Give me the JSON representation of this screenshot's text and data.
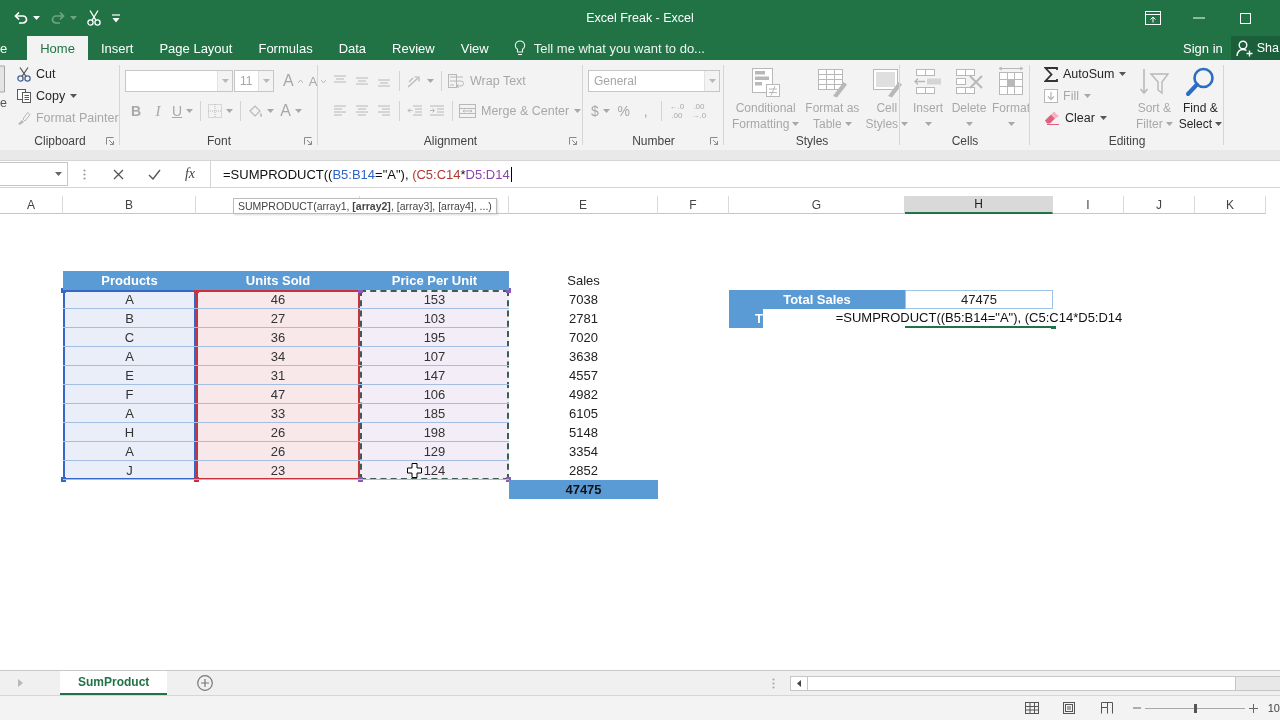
{
  "title_bar": {
    "quick_access": [
      {
        "disabled": false,
        "dropdown": true
      },
      {
        "disabled": true,
        "dropdown": true
      },
      {
        "disabled": false,
        "dropdown": false
      },
      {
        "disabled": false,
        "dropdown": false
      }
    ],
    "title": "Excel Freak - Excel"
  },
  "tabs": [
    {
      "label": "e",
      "selected": false
    },
    {
      "label": "Home",
      "selected": true
    },
    {
      "label": "Insert",
      "selected": false
    },
    {
      "label": "Page Layout",
      "selected": false
    },
    {
      "label": "Formulas",
      "selected": false
    },
    {
      "label": "Data",
      "selected": false
    },
    {
      "label": "Review",
      "selected": false
    },
    {
      "label": "View",
      "selected": false
    }
  ],
  "tell_me": "Tell me what you want to do...",
  "account": {
    "sign_in": "Sign in",
    "share": "Sha"
  },
  "ribbon": {
    "groups": [
      {
        "label": "Clipboard",
        "launcher": true,
        "stacks": [
          {
            "lines": [
              {
                "items": [
                  {
                    "kind": "fragment",
                    "label": "e"
                  }
                ]
              }
            ]
          },
          {
            "lines": [
              {
                "items": [
                  {
                    "kind": "small",
                    "label": "Cut",
                    "disabled": false,
                    "dropdown": false
                  }
                ]
              },
              {
                "items": [
                  {
                    "kind": "small",
                    "label": "Copy",
                    "disabled": false,
                    "dropdown": true
                  }
                ]
              },
              {
                "items": [
                  {
                    "kind": "small",
                    "label": "Format Painter",
                    "disabled": true,
                    "dropdown": false
                  }
                ]
              }
            ]
          }
        ]
      },
      {
        "label": "Font",
        "launcher": true,
        "stacks": [
          {
            "lines": [
              {
                "items": [
                  {
                    "kind": "combo",
                    "disabled": true
                  },
                  {
                    "kind": "combo",
                    "value": "11",
                    "disabled": true
                  },
                  {
                    "kind": "tool",
                    "label": "A",
                    "disabled": true,
                    "dropdown": false
                  },
                  {
                    "kind": "tool",
                    "label": "A",
                    "disabled": true,
                    "dropdown": false
                  }
                ]
              },
              {
                "items": [
                  {
                    "kind": "tool",
                    "label": "B",
                    "disabled": true,
                    "dropdown": false
                  },
                  {
                    "kind": "tool",
                    "label": "I",
                    "disabled": true,
                    "dropdown": false
                  },
                  {
                    "kind": "tool",
                    "label": "U",
                    "disabled": true,
                    "dropdown": true
                  },
                  {
                    "kind": "tool",
                    "disabled": true,
                    "dropdown": true
                  },
                  {
                    "kind": "tool",
                    "disabled": true,
                    "dropdown": true
                  },
                  {
                    "kind": "tool",
                    "label": "A",
                    "disabled": true,
                    "dropdown": true
                  }
                ]
              }
            ]
          }
        ]
      },
      {
        "label": "Alignment",
        "launcher": true,
        "stacks": [
          {
            "lines": [
              {
                "items": [
                  {
                    "kind": "tool",
                    "disabled": true,
                    "dropdown": false
                  },
                  {
                    "kind": "tool",
                    "disabled": true,
                    "dropdown": false
                  },
                  {
                    "kind": "tool",
                    "disabled": true,
                    "dropdown": false
                  },
                  {
                    "kind": "tool",
                    "disabled": true,
                    "dropdown": true
                  },
                  {
                    "kind": "small",
                    "label": "Wrap Text",
                    "disabled": true,
                    "dropdown": false
                  }
                ]
              },
              {
                "items": [
                  {
                    "kind": "tool",
                    "disabled": true,
                    "dropdown": false
                  },
                  {
                    "kind": "tool",
                    "disabled": true,
                    "dropdown": false
                  },
                  {
                    "kind": "tool",
                    "disabled": true,
                    "dropdown": false
                  },
                  {
                    "kind": "tool",
                    "disabled": true,
                    "dropdown": false
                  },
                  {
                    "kind": "tool",
                    "disabled": true,
                    "dropdown": false
                  },
                  {
                    "kind": "small",
                    "label": "Merge & Center",
                    "disabled": true,
                    "dropdown": true
                  }
                ]
              }
            ]
          }
        ]
      },
      {
        "label": "Number",
        "launcher": true,
        "stacks": [
          {
            "lines": [
              {
                "items": [
                  {
                    "kind": "combo",
                    "value": "General",
                    "disabled": true
                  }
                ]
              },
              {
                "items": [
                  {
                    "kind": "tool",
                    "label": "$",
                    "disabled": true,
                    "dropdown": true
                  },
                  {
                    "kind": "tool",
                    "label": "%",
                    "disabled": true,
                    "dropdown": false
                  },
                  {
                    "kind": "tool",
                    "label": ",",
                    "disabled": true,
                    "dropdown": false
                  },
                  {
                    "kind": "stack",
                    "lines": [
                      "←.0",
                      ".00"
                    ],
                    "disabled": true
                  },
                  {
                    "kind": "stack",
                    "lines": [
                      ".00",
                      "→.0"
                    ],
                    "disabled": true
                  }
                ]
              }
            ]
          }
        ]
      },
      {
        "label": "Styles",
        "launcher": false,
        "stacks": [
          {
            "lines": [
              {
                "items": [
                  {
                    "kind": "large",
                    "lines": [
                      "Conditional",
                      "Formatting"
                    ],
                    "disabled": true,
                    "dropdown": true
                  }
                ]
              }
            ]
          },
          {
            "lines": [
              {
                "items": [
                  {
                    "kind": "large",
                    "lines": [
                      "Format as",
                      "Table"
                    ],
                    "disabled": true,
                    "dropdown": true
                  }
                ]
              }
            ]
          },
          {
            "lines": [
              {
                "items": [
                  {
                    "kind": "large",
                    "lines": [
                      "Cell",
                      "Styles"
                    ],
                    "disabled": true,
                    "dropdown": true
                  }
                ]
              }
            ]
          }
        ]
      },
      {
        "label": "Cells",
        "launcher": false,
        "stacks": [
          {
            "lines": [
              {
                "items": [
                  {
                    "kind": "large",
                    "lines": [
                      "Insert"
                    ],
                    "disabled": true,
                    "dropdown": true
                  }
                ]
              }
            ]
          },
          {
            "lines": [
              {
                "items": [
                  {
                    "kind": "large",
                    "lines": [
                      "Delete"
                    ],
                    "disabled": true,
                    "dropdown": true
                  }
                ]
              }
            ]
          },
          {
            "lines": [
              {
                "items": [
                  {
                    "kind": "large",
                    "lines": [
                      "Format"
                    ],
                    "disabled": true,
                    "dropdown": true
                  }
                ]
              }
            ]
          }
        ]
      },
      {
        "label": "Editing",
        "launcher": false,
        "stacks": [
          {
            "lines": [
              {
                "items": [
                  {
                    "kind": "small",
                    "label": "AutoSum",
                    "disabled": false,
                    "dropdown": true
                  }
                ]
              },
              {
                "items": [
                  {
                    "kind": "small",
                    "label": "Fill",
                    "disabled": true,
                    "dropdown": true
                  }
                ]
              },
              {
                "items": [
                  {
                    "kind": "small",
                    "label": "Clear",
                    "disabled": false,
                    "dropdown": true
                  }
                ]
              }
            ]
          },
          {
            "lines": [
              {
                "items": [
                  {
                    "kind": "large",
                    "lines": [
                      "Sort &",
                      "Filter"
                    ],
                    "disabled": true,
                    "dropdown": true
                  }
                ]
              }
            ]
          },
          {
            "lines": [
              {
                "items": [
                  {
                    "kind": "large",
                    "lines": [
                      "Find &",
                      "Select"
                    ],
                    "disabled": false,
                    "dropdown": true
                  }
                ]
              }
            ]
          }
        ]
      }
    ]
  },
  "formula_bar": {
    "fx": "fx",
    "formula": [
      {
        "text": "=SUMPRODUCT(("
      },
      {
        "text": "B5:B14",
        "color": "#2e64c8"
      },
      {
        "text": "=\"A\"), "
      },
      {
        "text": "(C5:C14",
        "color": "#b03a36"
      },
      {
        "text": "*"
      },
      {
        "text": "D5:D14",
        "color": "#8e44ad"
      }
    ]
  },
  "sheet": {
    "columns": [
      {
        "label": "A",
        "selected": false
      },
      {
        "label": "B",
        "selected": false
      },
      {
        "selected": false
      },
      {
        "selected": false
      },
      {
        "label": "E",
        "selected": false
      },
      {
        "label": "F",
        "selected": false
      },
      {
        "label": "G",
        "selected": false
      },
      {
        "label": "H",
        "selected": true
      },
      {
        "label": "I",
        "selected": false
      },
      {
        "label": "J",
        "selected": false
      },
      {
        "label": "K",
        "selected": false
      }
    ],
    "tooltip": "SUMPRODUCT(array1, **[array2]**, [array3], [array4], ...)",
    "table": {
      "columns": [
        {
          "header": "Products",
          "color": "#3567c8",
          "marquee": false
        },
        {
          "header": "Units Sold",
          "color": "#c8323c",
          "marquee": false
        },
        {
          "header": "Price Per Unit",
          "color": "#8a5cb8",
          "marquee": true
        }
      ],
      "rows": [
        [
          "A",
          "46",
          "153"
        ],
        [
          "B",
          "27",
          "103"
        ],
        [
          "C",
          "36",
          "195"
        ],
        [
          "A",
          "34",
          "107"
        ],
        [
          "E",
          "31",
          "147"
        ],
        [
          "F",
          "47",
          "106"
        ],
        [
          "A",
          "33",
          "185"
        ],
        [
          "H",
          "26",
          "198"
        ],
        [
          "A",
          "26",
          "129"
        ],
        [
          "J",
          "23",
          "124"
        ]
      ]
    },
    "sales": {
      "header": "Sales",
      "values": [
        "7038",
        "2781",
        "7020",
        "3638",
        "4557",
        "4982",
        "6105",
        "5148",
        "3354",
        "2852"
      ],
      "total": "47475"
    },
    "summary": {
      "label": "Total Sales",
      "value": "47475",
      "label_2": "T",
      "edit_text": "=SUMPRODUCT((B5:B14=\"A\"), (C5:C14*D5:D14"
    }
  },
  "sheet_tabs": [
    {
      "label": "SumProduct",
      "selected": true
    }
  ],
  "status_bar": {
    "zoom": {
      "level": 0.5
    },
    "zoom_label": "10"
  }
}
